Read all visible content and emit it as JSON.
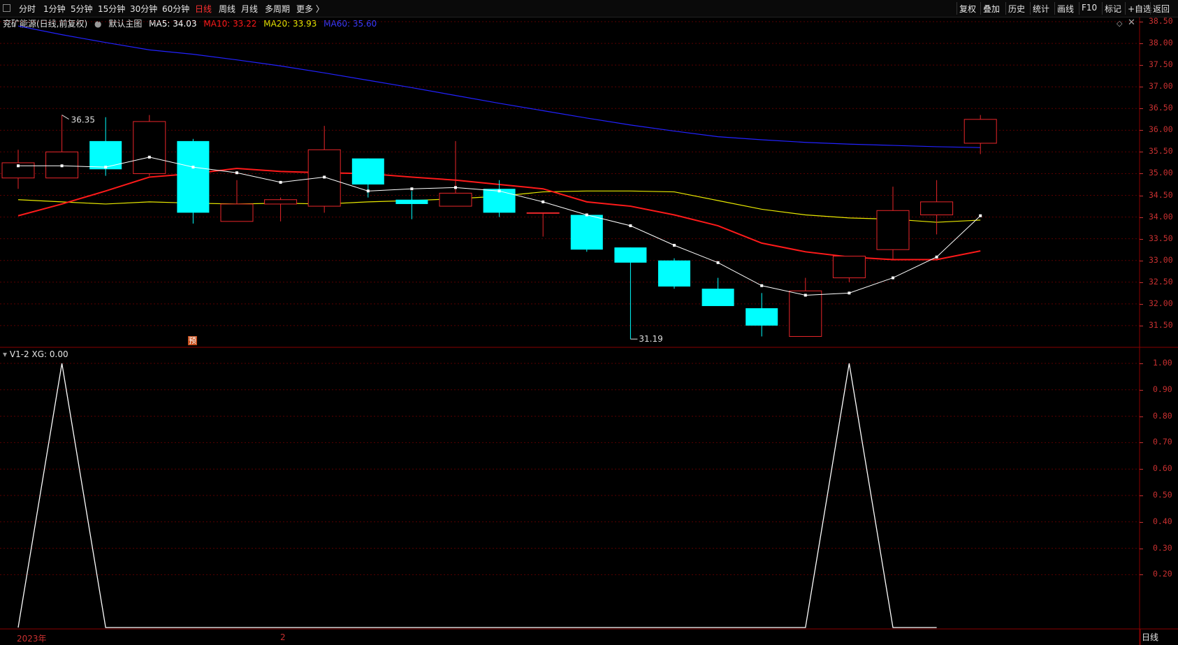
{
  "toolbar": {
    "left_tabs": [
      "分时",
      "1分钟",
      "5分钟",
      "15分钟",
      "30分钟",
      "60分钟",
      "日线",
      "周线",
      "月线",
      "多周期",
      "更多 〉"
    ],
    "active_tab": "日线",
    "right_buttons": [
      "复权",
      "叠加",
      "历史",
      "统计",
      "画线",
      "F10",
      "标记",
      "+自选",
      "返回"
    ]
  },
  "main_legend": {
    "stock_name": "兖矿能源(日线,前复权)",
    "template": "默认主图",
    "ma5": "MA5: 34.03",
    "ma10": "MA10: 33.22",
    "ma20": "MA20: 33.93",
    "ma60": "MA60: 35.60"
  },
  "colors": {
    "up": "#e8262a",
    "down": "#00ffff",
    "ma5": "#ffffff",
    "ma10": "#ff1a1a",
    "ma20": "#e8e800",
    "ma60": "#2222ff",
    "axis": "#c83030",
    "grid": "#5a0000"
  },
  "price_annotations": {
    "high": "36.35",
    "low": "31.19"
  },
  "marker_tag": "预",
  "sub_legend": {
    "indicator": "V1-2",
    "value": "XG: 0.00"
  },
  "main_yaxis": [
    "38.50",
    "38.00",
    "37.50",
    "37.00",
    "36.50",
    "36.00",
    "35.50",
    "35.00",
    "34.50",
    "34.00",
    "33.50",
    "33.00",
    "32.50",
    "32.00",
    "31.50"
  ],
  "sub_yaxis": [
    "1.00",
    "0.90",
    "0.80",
    "0.70",
    "0.60",
    "0.50",
    "0.40",
    "0.30",
    "0.20"
  ],
  "xaxis": {
    "year_label": "2023年",
    "month_label": "2"
  },
  "period_label": "日线",
  "chart_data": [
    {
      "type": "candlestick",
      "ylim": [
        31.0,
        38.5
      ],
      "candles": [
        {
          "o": 34.9,
          "h": 35.55,
          "l": 34.65,
          "c": 35.25
        },
        {
          "o": 34.9,
          "h": 36.35,
          "l": 34.9,
          "c": 35.5
        },
        {
          "o": 35.75,
          "h": 36.3,
          "l": 34.95,
          "c": 35.1
        },
        {
          "o": 35.0,
          "h": 36.35,
          "l": 34.95,
          "c": 36.2
        },
        {
          "o": 35.75,
          "h": 35.8,
          "l": 33.85,
          "c": 34.1
        },
        {
          "o": 33.9,
          "h": 34.85,
          "l": 33.9,
          "c": 34.3
        },
        {
          "o": 34.3,
          "h": 34.45,
          "l": 33.9,
          "c": 34.4
        },
        {
          "o": 34.25,
          "h": 36.1,
          "l": 34.1,
          "c": 35.55
        },
        {
          "o": 35.35,
          "h": 35.35,
          "l": 34.45,
          "c": 34.75
        },
        {
          "o": 34.4,
          "h": 34.6,
          "l": 33.95,
          "c": 34.3
        },
        {
          "o": 34.25,
          "h": 35.75,
          "l": 34.25,
          "c": 34.55
        },
        {
          "o": 34.65,
          "h": 34.85,
          "l": 34.0,
          "c": 34.1
        },
        {
          "o": 34.1,
          "h": 34.1,
          "l": 33.55,
          "c": 34.1
        },
        {
          "o": 34.05,
          "h": 34.05,
          "l": 33.2,
          "c": 33.25
        },
        {
          "o": 33.3,
          "h": 33.3,
          "l": 31.19,
          "c": 32.95
        },
        {
          "o": 33.0,
          "h": 33.05,
          "l": 32.35,
          "c": 32.4
        },
        {
          "o": 32.35,
          "h": 32.6,
          "l": 31.95,
          "c": 31.95
        },
        {
          "o": 31.9,
          "h": 32.25,
          "l": 31.25,
          "c": 31.5
        },
        {
          "o": 31.25,
          "h": 32.6,
          "l": 31.25,
          "c": 32.3
        },
        {
          "o": 32.6,
          "h": 33.05,
          "l": 32.5,
          "c": 33.1
        },
        {
          "o": 33.25,
          "h": 34.7,
          "l": 33.0,
          "c": 34.15
        },
        {
          "o": 34.05,
          "h": 34.85,
          "l": 33.6,
          "c": 34.35
        },
        {
          "o": 35.7,
          "h": 36.35,
          "l": 35.45,
          "c": 36.25
        }
      ],
      "ma5": [
        35.18,
        35.18,
        35.15,
        35.38,
        35.15,
        35.02,
        34.8,
        34.92,
        34.6,
        34.65,
        34.68,
        34.6,
        34.35,
        34.05,
        33.8,
        33.35,
        32.95,
        32.42,
        32.2,
        32.25,
        32.6,
        33.08,
        34.03
      ],
      "ma10": [
        34.03,
        34.3,
        34.6,
        34.92,
        35.0,
        35.12,
        35.05,
        35.02,
        35.0,
        34.92,
        34.85,
        34.75,
        34.65,
        34.35,
        34.25,
        34.05,
        33.8,
        33.4,
        33.2,
        33.08,
        33.02,
        33.02,
        33.22
      ],
      "ma20": [
        34.4,
        34.35,
        34.3,
        34.35,
        34.32,
        34.3,
        34.32,
        34.3,
        34.35,
        34.38,
        34.42,
        34.48,
        34.58,
        34.6,
        34.6,
        34.58,
        34.38,
        34.18,
        34.05,
        33.98,
        33.95,
        33.88,
        33.93
      ],
      "ma60": [
        38.4,
        38.2,
        38.02,
        37.85,
        37.75,
        37.62,
        37.48,
        37.32,
        37.15,
        36.98,
        36.8,
        36.62,
        36.45,
        36.28,
        36.12,
        35.98,
        35.85,
        35.78,
        35.72,
        35.68,
        35.65,
        35.62,
        35.6
      ]
    },
    {
      "type": "line",
      "title": "V1-2",
      "series": [
        {
          "name": "XG",
          "values": [
            0,
            1,
            0,
            0,
            0,
            0,
            0,
            0,
            0,
            0,
            0,
            0,
            0,
            0,
            0,
            0,
            0,
            0,
            0,
            1,
            0,
            0
          ]
        }
      ],
      "ylim": [
        0,
        1.0
      ]
    }
  ]
}
